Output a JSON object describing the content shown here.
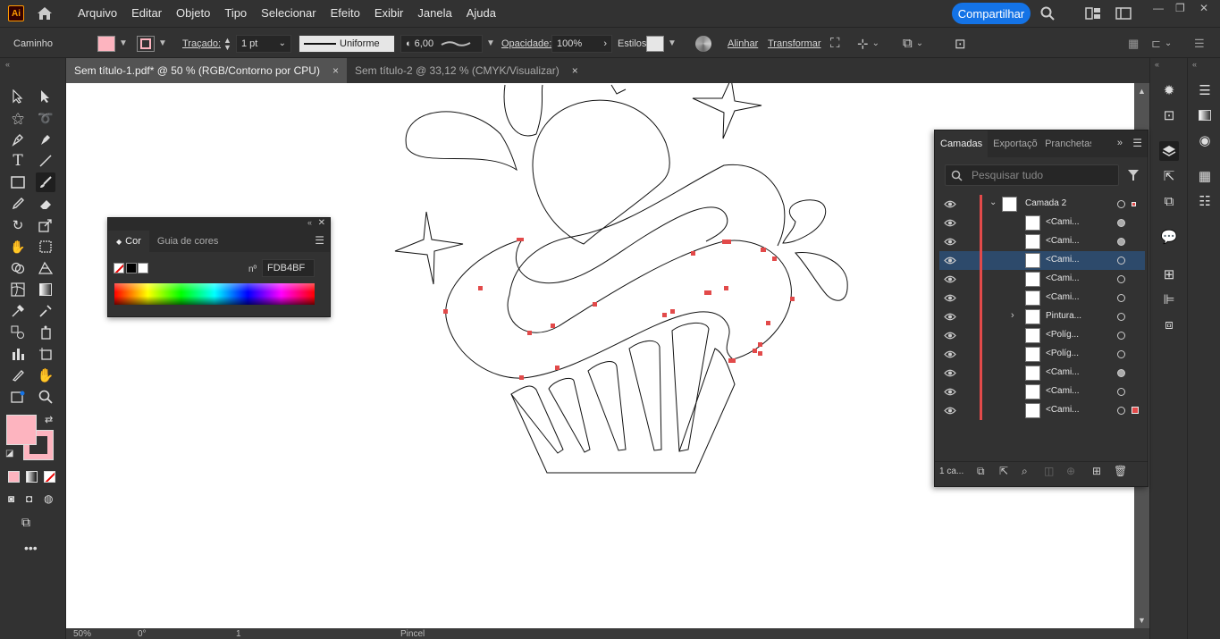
{
  "app": {
    "logo_text": "Ai",
    "menu": [
      "Arquivo",
      "Editar",
      "Objeto",
      "Tipo",
      "Selecionar",
      "Efeito",
      "Exibir",
      "Janela",
      "Ajuda"
    ],
    "share_label": "Compartilhar"
  },
  "controlbar": {
    "selection_type": "Caminho",
    "fill_color": "#FDB4BF",
    "stroke_label": "Traçado:",
    "stroke_weight": "1 pt",
    "profile_label": "Uniforme",
    "brush_size": "6,00",
    "opacity_label": "Opacidade:",
    "opacity_value": "100%",
    "style_label": "Estilos:",
    "align_label": "Alinhar",
    "transform_label": "Transformar"
  },
  "tabs": [
    {
      "label": "Sem título-1.pdf* @ 50 % (RGB/Contorno por CPU)",
      "close": "×"
    },
    {
      "label": "Sem título-2 @ 33,12 % (CMYK/Visualizar)",
      "close": "×"
    }
  ],
  "color_panel": {
    "tabs": [
      "Cor",
      "Guia de cores"
    ],
    "hex_label": "nº",
    "hex_value": "FDB4BF"
  },
  "layers_panel": {
    "tabs": [
      "Camadas",
      "Exportaçõ",
      "Pranchetas"
    ],
    "search_placeholder": "Pesquisar tudo",
    "rows": [
      {
        "name": "Camada 2",
        "type": "layer"
      },
      {
        "name": "<Cami...",
        "type": "path"
      },
      {
        "name": "<Cami...",
        "type": "path"
      },
      {
        "name": "<Cami...",
        "type": "path",
        "selected": true
      },
      {
        "name": "<Cami...",
        "type": "path"
      },
      {
        "name": "<Cami...",
        "type": "path"
      },
      {
        "name": "Pintura...",
        "type": "group"
      },
      {
        "name": "<Políg...",
        "type": "polygon"
      },
      {
        "name": "<Políg...",
        "type": "polygon"
      },
      {
        "name": "<Cami...",
        "type": "path"
      },
      {
        "name": "<Cami...",
        "type": "path"
      },
      {
        "name": "<Cami...",
        "type": "path"
      }
    ],
    "footer_count": "1 ca..."
  },
  "statusbar": {
    "zoom": "50%",
    "rotation": "0°",
    "artboard": "1",
    "tool_name": "Pincel"
  }
}
